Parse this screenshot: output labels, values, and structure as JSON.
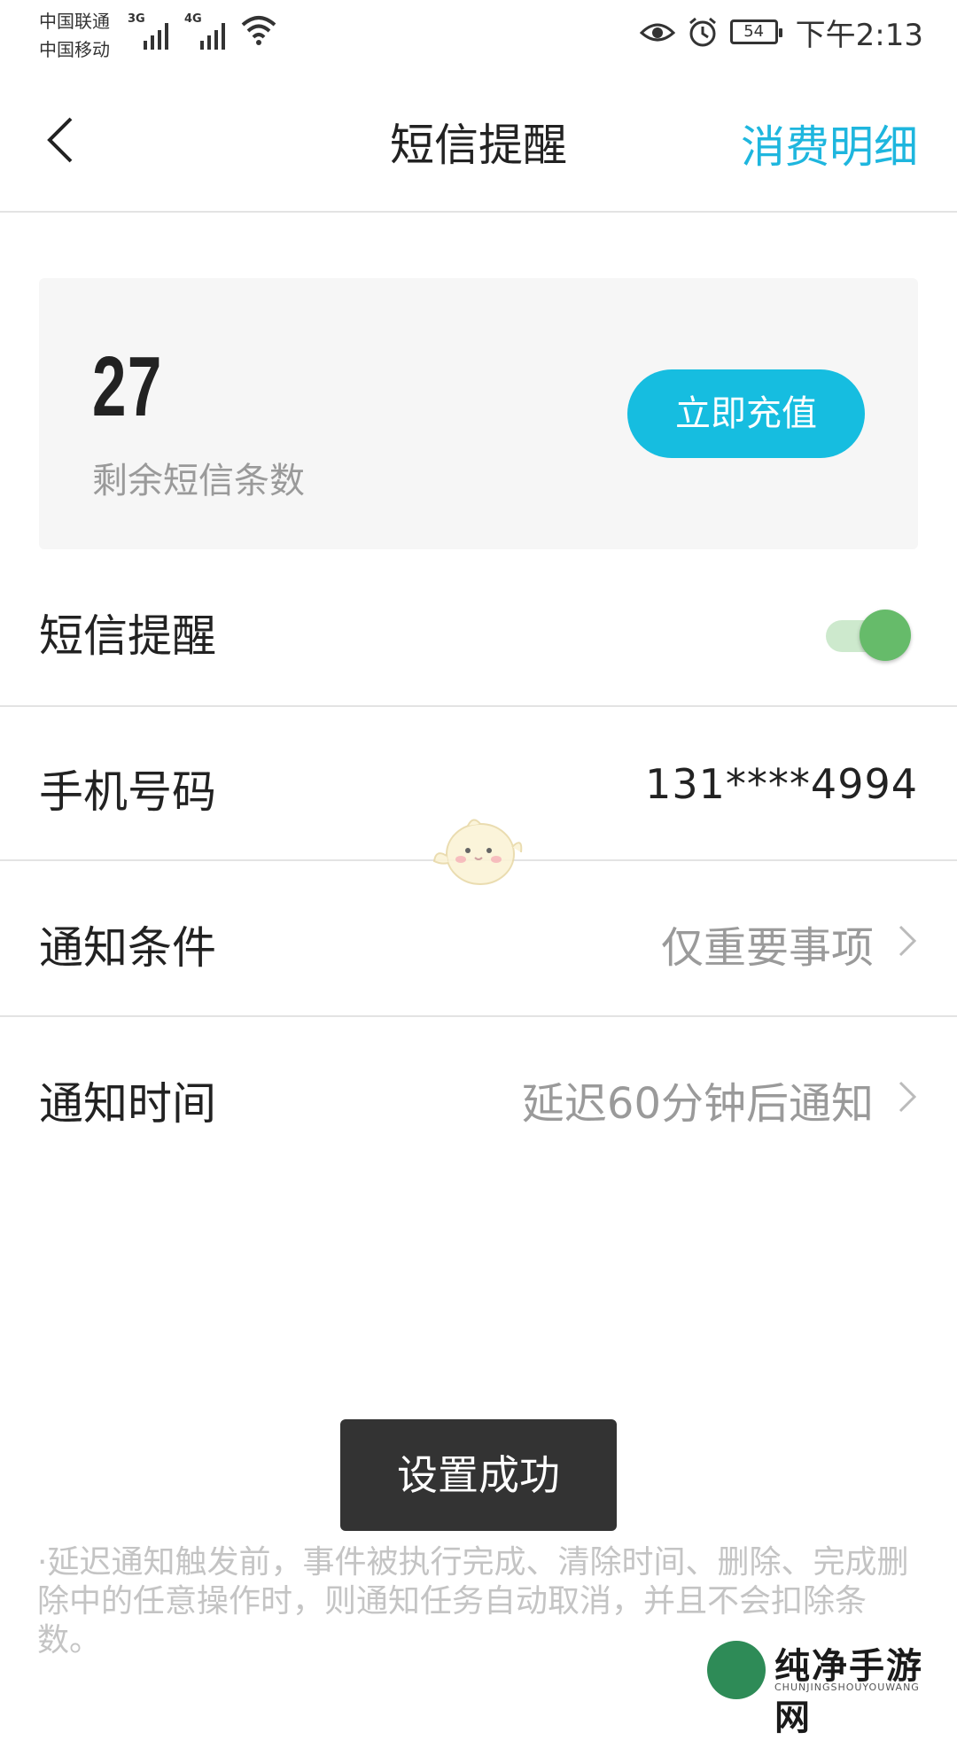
{
  "status_bar": {
    "carrier_1": "中国联通",
    "carrier_2": "中国移动",
    "network_1": "3G",
    "network_2": "4G",
    "battery": "54",
    "time": "下午2:13",
    "icons": [
      "signal-icon",
      "wifi-icon",
      "eye-icon",
      "alarm-icon",
      "battery-icon"
    ]
  },
  "header": {
    "title": "短信提醒",
    "right_link": "消费明细",
    "back_icon": "back-arrow-icon"
  },
  "balance_card": {
    "count": "27",
    "caption": "剩余短信条数",
    "recharge_label": "立即充值"
  },
  "sms_reminder": {
    "label": "短信提醒",
    "enabled": true
  },
  "phone": {
    "label": "手机号码",
    "value": "131****4994"
  },
  "notify_condition": {
    "label": "通知条件",
    "value": "仅重要事项"
  },
  "notify_time": {
    "label": "通知时间",
    "value": "延迟60分钟后通知"
  },
  "toast": {
    "text": "设置成功"
  },
  "note": {
    "text": "·延迟通知触发前，事件被执行完成、清除时间、删除、完成删除中的任意操作时，则通知任务自动取消，并且不会扣除条数。"
  },
  "watermark": {
    "brand": "纯净手游网",
    "sub": "CHUNJINGSHOUYOUWANG"
  },
  "colors": {
    "accent": "#1eb6de",
    "button": "#16bde0",
    "toggle_on": "#66bb6a",
    "toast_bg": "#333333"
  }
}
